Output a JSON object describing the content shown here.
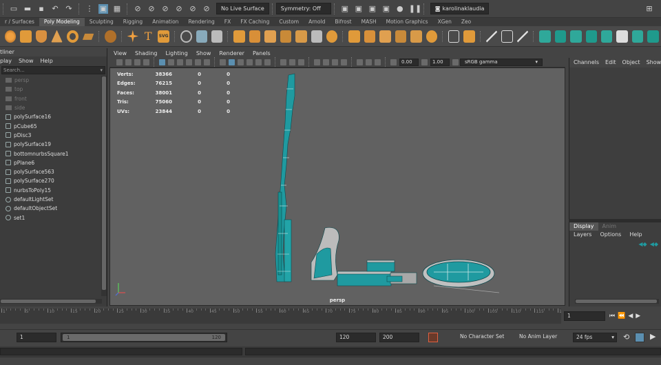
{
  "statusline": {
    "live_surface": "No Live Surface",
    "symmetry": "Symmetry: Off",
    "user": "karolinaklaudia"
  },
  "shelf_tabs": [
    "r / Surfaces",
    "Poly Modeling",
    "Sculpting",
    "Rigging",
    "Animation",
    "Rendering",
    "FX",
    "FX Caching",
    "Custom",
    "Arnold",
    "Bifrost",
    "MASH",
    "Motion Graphics",
    "XGen",
    "Zeo"
  ],
  "shelf_active_tab": "Poly Modeling",
  "shelf_text_tool": "T",
  "shelf_svg_tool": "SVG",
  "outliner": {
    "title": "tliner",
    "menu": [
      "play",
      "Show",
      "Help"
    ],
    "search_placeholder": "Search...",
    "items": [
      {
        "label": "persp",
        "dim": true,
        "kind": "camera"
      },
      {
        "label": "top",
        "dim": true,
        "kind": "camera"
      },
      {
        "label": "front",
        "dim": true,
        "kind": "camera"
      },
      {
        "label": "side",
        "dim": true,
        "kind": "camera"
      },
      {
        "label": "polySurface16",
        "dim": false,
        "kind": "mesh"
      },
      {
        "label": "pCube65",
        "dim": false,
        "kind": "mesh"
      },
      {
        "label": "pDisc3",
        "dim": false,
        "kind": "mesh"
      },
      {
        "label": "polySurface19",
        "dim": false,
        "kind": "mesh"
      },
      {
        "label": "bottomnurbsSquare1",
        "dim": false,
        "kind": "mesh"
      },
      {
        "label": "pPlane6",
        "dim": false,
        "kind": "mesh"
      },
      {
        "label": "polySurface563",
        "dim": false,
        "kind": "mesh"
      },
      {
        "label": "polySurface270",
        "dim": false,
        "kind": "mesh"
      },
      {
        "label": "nurbsToPoly15",
        "dim": false,
        "kind": "mesh"
      },
      {
        "label": "defaultLightSet",
        "dim": false,
        "kind": "set"
      },
      {
        "label": "defaultObjectSet",
        "dim": false,
        "kind": "set"
      },
      {
        "label": "set1",
        "dim": false,
        "kind": "set"
      }
    ]
  },
  "viewport": {
    "menu": [
      "View",
      "Shading",
      "Lighting",
      "Show",
      "Renderer",
      "Panels"
    ],
    "exposure": "0.00",
    "gamma": "1.00",
    "color_space": "sRGB gamma",
    "camera": "persp",
    "hud": [
      {
        "label": "Verts:",
        "v1": "38366",
        "v2": "0",
        "v3": "0"
      },
      {
        "label": "Edges:",
        "v1": "76215",
        "v2": "0",
        "v3": "0"
      },
      {
        "label": "Faces:",
        "v1": "38001",
        "v2": "0",
        "v3": "0"
      },
      {
        "label": "Tris:",
        "v1": "75060",
        "v2": "0",
        "v3": "0"
      },
      {
        "label": "UVs:",
        "v1": "23844",
        "v2": "0",
        "v3": "0"
      }
    ]
  },
  "channels": {
    "menu": [
      "Channels",
      "Edit",
      "Object",
      "Show"
    ]
  },
  "layers": {
    "tabs": [
      "Display",
      "Anim"
    ],
    "menu": [
      "Layers",
      "Options",
      "Help"
    ]
  },
  "timeslider": {
    "ticks": [
      "1",
      "5",
      "10",
      "15",
      "20",
      "25",
      "30",
      "35",
      "40",
      "45",
      "50",
      "55",
      "60",
      "65",
      "70",
      "75",
      "80",
      "85",
      "90",
      "95",
      "100",
      "105",
      "110",
      "115",
      "12"
    ],
    "current_frame": "1"
  },
  "range": {
    "start": "1",
    "slider_start": "1",
    "slider_end": "120",
    "anim_end": "120",
    "playback_end": "200",
    "character_set": "No Character Set",
    "anim_layer": "No Anim Layer",
    "fps": "24 fps"
  },
  "colors": {
    "accent": "#5b8fb0",
    "model": "#1f9aa0",
    "viewport_bg": "#616161"
  }
}
